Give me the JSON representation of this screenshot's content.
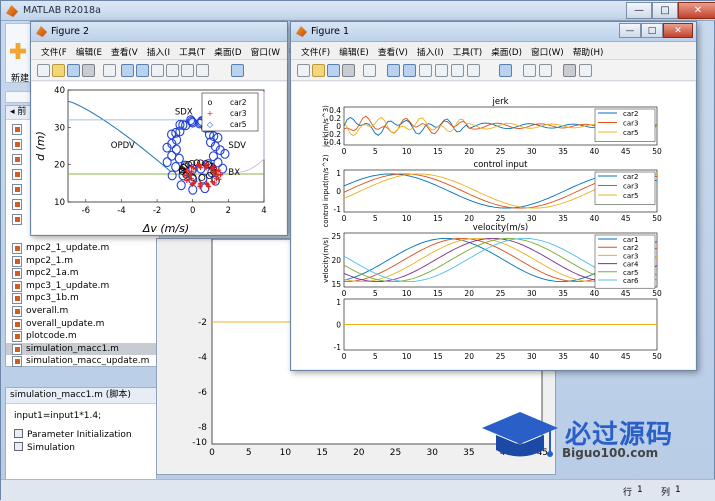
{
  "main": {
    "title": "MATLAB R2018a",
    "new_label": "新建",
    "nav_label": "前",
    "files": [
      "mpc2_1_update.m",
      "mpc2_1.m",
      "mpc2_1a.m",
      "mpc3_1_update.m",
      "mpc3_1b.m",
      "overall.m",
      "overall_update.m",
      "plotcode.m",
      "simulation_macc1.m",
      "simulation_macc_update.m"
    ],
    "selected_file": "simulation_macc1.m",
    "details_title": "simulation_macc1.m  (脚本)",
    "details_lines": [
      "input1=input1*1.4;"
    ],
    "cells": [
      "Parameter Initialization",
      "Simulation"
    ],
    "status": {
      "row_label": "行",
      "row": "1",
      "col_label": "列",
      "col": "1"
    }
  },
  "bg_figure": {
    "y_ticks": [
      "-2",
      "0",
      "-4",
      "-6",
      "-8",
      "-10"
    ],
    "x_ticks": [
      "0",
      "5",
      "10",
      "15",
      "20",
      "25",
      "30",
      "35",
      "40",
      "45"
    ],
    "line_color": "#edb120"
  },
  "figure2": {
    "title": "Figure 2",
    "menu": [
      "文件(F",
      "编辑(E",
      "查看(V",
      "插入(I",
      "工具(T",
      "桌面(D",
      "窗口(W",
      "帮助(H"
    ],
    "chart_data": {
      "type": "scatter",
      "xlabel": "Δv (m/s)",
      "ylabel": "d (m)",
      "xlim": [
        -7,
        4
      ],
      "ylim": [
        10,
        40
      ],
      "x_ticks": [
        "-6",
        "-4",
        "-2",
        "0",
        "2",
        "4"
      ],
      "y_ticks": [
        "10",
        "20",
        "30",
        "40"
      ],
      "region_labels": [
        "SDX",
        "OPDV",
        "SDV",
        "BX"
      ],
      "legend": [
        "car2",
        "car3",
        "car5"
      ],
      "legend_markers": [
        "o",
        "+",
        "◇"
      ],
      "colors": {
        "car2": "#000000",
        "car3": "#d62728",
        "car5": "#1f3fd8",
        "opdv_line": "#1f77b4",
        "sdx_line": "#4a4ab0",
        "bx_line": "#8db24a"
      }
    }
  },
  "figure1": {
    "title": "Figure 1",
    "menu": [
      "文件(F)",
      "编辑(E)",
      "查看(V)",
      "插入(I)",
      "工具(T)",
      "桌面(D)",
      "窗口(W)",
      "帮助(H)"
    ],
    "chart_data": [
      {
        "type": "line",
        "title": "jerk",
        "ylabel": "jerk(m/s^3)",
        "xlim": [
          0,
          50
        ],
        "ylim": [
          -0.4,
          0.4
        ],
        "y_ticks": [
          "0.4",
          "0.2",
          "0",
          "-0.2",
          "-0.4"
        ],
        "x_ticks": [
          "0",
          "5",
          "10",
          "15",
          "20",
          "25",
          "30",
          "35",
          "40",
          "45",
          "50"
        ],
        "series": [
          {
            "name": "car2",
            "color": "#0072bd"
          },
          {
            "name": "car3",
            "color": "#d95319"
          },
          {
            "name": "car5",
            "color": "#edb120"
          }
        ]
      },
      {
        "type": "line",
        "title": "control input",
        "ylabel": "control input(m/s^2)",
        "xlim": [
          0,
          50
        ],
        "ylim": [
          -1,
          1
        ],
        "y_ticks": [
          "1",
          "0",
          "-1"
        ],
        "x_ticks": [
          "0",
          "5",
          "10",
          "15",
          "20",
          "25",
          "30",
          "35",
          "40",
          "45",
          "50"
        ],
        "series": [
          {
            "name": "car2",
            "color": "#0072bd"
          },
          {
            "name": "car3",
            "color": "#d95319"
          },
          {
            "name": "car5",
            "color": "#edb120"
          }
        ]
      },
      {
        "type": "line",
        "title": "velocity(m/s)",
        "ylabel": "velocity(m/s)",
        "xlim": [
          0,
          50
        ],
        "ylim": [
          15,
          25
        ],
        "y_ticks": [
          "25",
          "20",
          "15"
        ],
        "x_ticks": [
          "0",
          "5",
          "10",
          "15",
          "20",
          "25",
          "30",
          "35",
          "40",
          "45",
          "50"
        ],
        "series": [
          {
            "name": "car1",
            "color": "#0072bd"
          },
          {
            "name": "car2",
            "color": "#d95319"
          },
          {
            "name": "car3",
            "color": "#edb120"
          },
          {
            "name": "car4",
            "color": "#7e2f8e"
          },
          {
            "name": "car5",
            "color": "#77ac30"
          },
          {
            "name": "car6",
            "color": "#4dbeee"
          }
        ]
      },
      {
        "type": "line",
        "title": "",
        "ylabel": "",
        "xlim": [
          0,
          50
        ],
        "ylim": [
          -1,
          1
        ],
        "y_ticks": [
          "1",
          "0",
          "-1"
        ],
        "x_ticks": [
          "0",
          "5",
          "10",
          "15",
          "20",
          "25",
          "30",
          "35",
          "40",
          "45",
          "50"
        ],
        "series": [
          {
            "name": "",
            "color": "#edb120",
            "values": [
              0,
              0
            ]
          }
        ]
      }
    ]
  },
  "watermark": {
    "brand": "必过源码",
    "url": "Biguo100.com"
  }
}
